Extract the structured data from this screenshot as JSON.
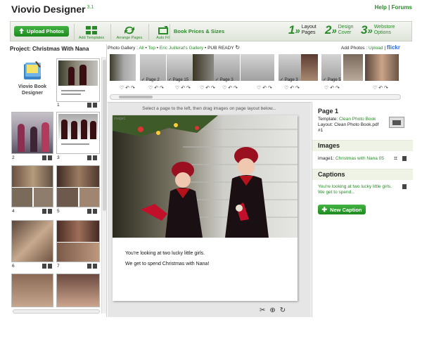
{
  "app": {
    "name": "Viovio Designer",
    "version": "3.1"
  },
  "top_links": {
    "help": "Help",
    "sep": "|",
    "forums": "Forums"
  },
  "toolbar": {
    "upload": "Upload Photos",
    "add_templates": "Add Templates",
    "arrange_pages": "Arrange Pages",
    "auto_fill": "Auto Fill",
    "prices": "Book Prices & Sizes",
    "steps": [
      {
        "num": "1",
        "line1": "Layout",
        "line2": "Pages"
      },
      {
        "num": "2",
        "line1": "Design",
        "line2": "Cover"
      },
      {
        "num": "3",
        "line1": "Webstore",
        "line2": "Options"
      }
    ]
  },
  "project": {
    "label": "Project: Christmas With Nana",
    "logo_line1": "Viovio Book",
    "logo_line2": "Designer",
    "page_numbers": [
      "1",
      "2",
      "3",
      "4",
      "5",
      "6",
      "7"
    ]
  },
  "gallery": {
    "prefix": "Photo Gallery :",
    "crumb_all": "All",
    "crumb_top": "Top",
    "crumb_user": "Eric Juillerat's Gallery",
    "crumb_current": "PUB READY",
    "add_photos": "Add Photos :",
    "upload": "Upload",
    "flickr": "flickr",
    "labels": [
      "",
      "Page 2",
      "Page 15",
      "",
      "Page 3",
      "",
      "Page 3",
      "",
      "Page 5",
      "",
      ""
    ]
  },
  "canvas": {
    "instruction": "Select a page to the left, then drag images on page layout below...",
    "slot_label": "image1",
    "caption_line1": "You're looking at two lucky little girls.",
    "caption_line2": "We get to spend Christmas with Nana!"
  },
  "details": {
    "page_title": "Page 1",
    "template_label": "Template:",
    "template_value": "Clean Photo Book",
    "layout_label": "Layout:",
    "layout_value": "Clean Photo Book.pdf",
    "layout_num": "#1",
    "images_title": "Images",
    "image_slot": "image1:",
    "image_name": "Christmas with Nana 05",
    "captions_title": "Captions",
    "caption_preview": "You're looking at two lucky little girls. We get to spend...",
    "new_caption": "New Caption"
  },
  "colors": {
    "accent": "#2a8a2a",
    "button": "#239623"
  }
}
